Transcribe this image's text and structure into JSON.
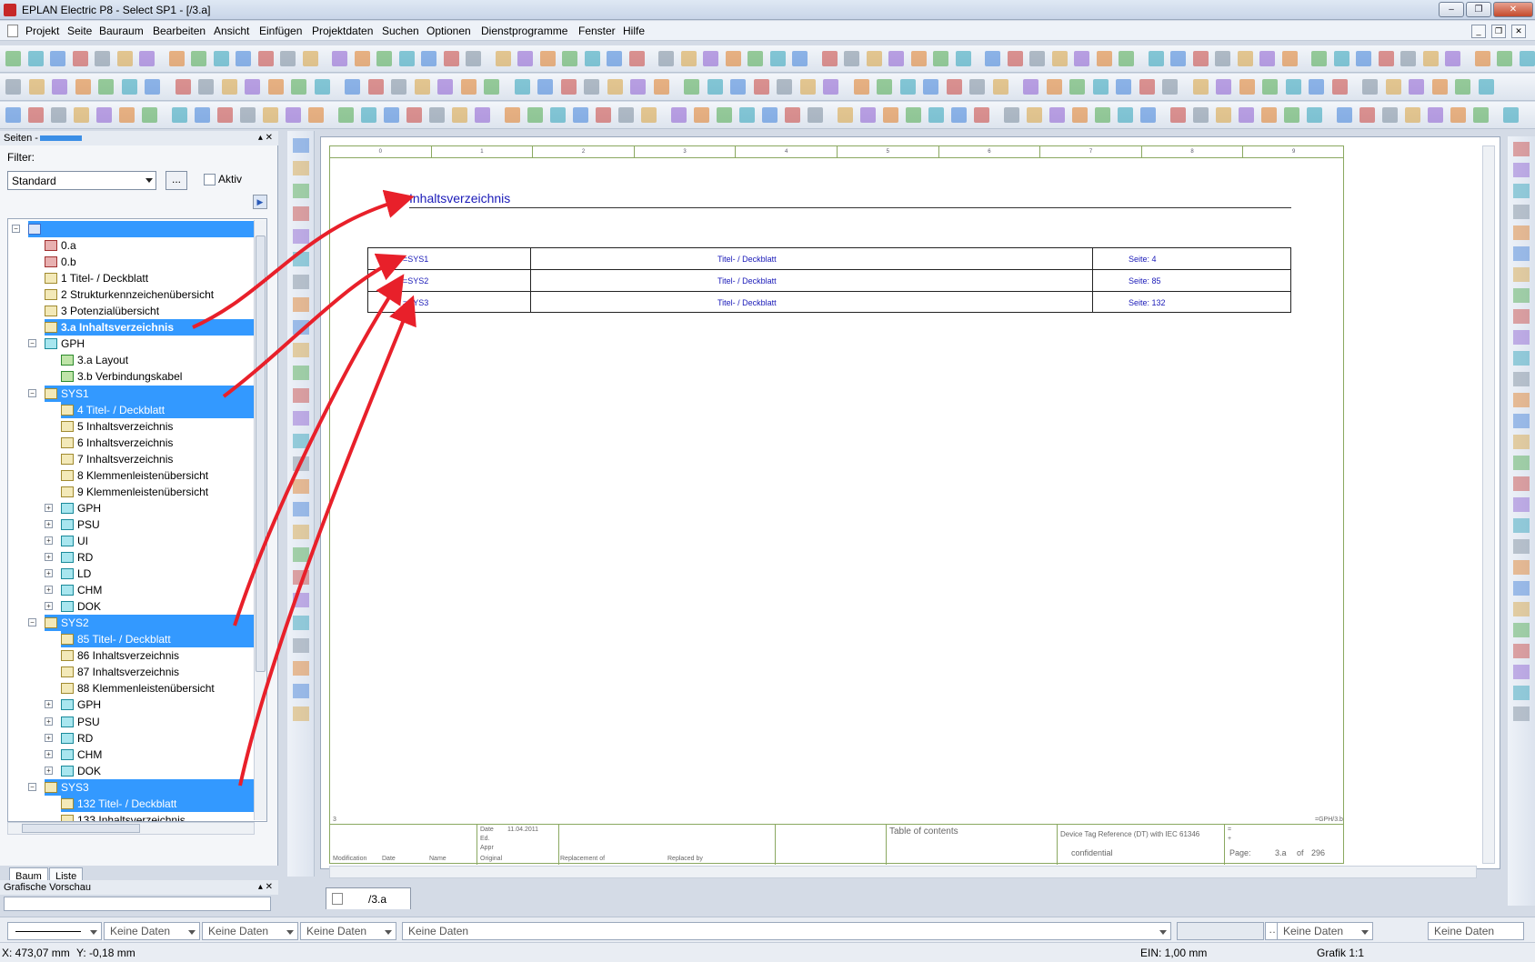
{
  "window": {
    "title": "EPLAN Electric P8 - Select SP1 - [/3.a]"
  },
  "menu": [
    "Projekt",
    "Seite",
    "Bauraum",
    "Bearbeiten",
    "Ansicht",
    "Einfügen",
    "Projektdaten",
    "Suchen",
    "Optionen",
    "Dienstprogramme",
    "Fenster",
    "Hilfe"
  ],
  "pages_panel": {
    "title": "Seiten -",
    "filter_label": "Filter:",
    "filter_value": "Standard",
    "filter_button": "...",
    "active_label": "Aktiv",
    "tabs": [
      "Baum",
      "Liste"
    ],
    "tree": [
      {
        "label": "",
        "level": 0,
        "icon": "project",
        "selected": true,
        "expander": "minus"
      },
      {
        "label": "0.a",
        "level": 1,
        "icon": "red"
      },
      {
        "label": "0.b",
        "level": 1,
        "icon": "red"
      },
      {
        "label": "1 Titel- / Deckblatt",
        "level": 1,
        "icon": "page"
      },
      {
        "label": "2 Strukturkennzeichenübersicht",
        "level": 1,
        "icon": "page"
      },
      {
        "label": "3 Potenzialübersicht",
        "level": 1,
        "icon": "page"
      },
      {
        "label": "3.a Inhaltsverzeichnis",
        "level": 1,
        "icon": "page",
        "selected": true,
        "bold": true
      },
      {
        "label": "GPH",
        "level": 1,
        "icon": "struct",
        "expander": "minus"
      },
      {
        "label": "3.a Layout",
        "level": 2,
        "icon": "green"
      },
      {
        "label": "3.b Verbindungskabel",
        "level": 2,
        "icon": "green"
      },
      {
        "label": "SYS1",
        "level": 1,
        "icon": "page",
        "selected": true,
        "expander": "minus"
      },
      {
        "label": "4 Titel- / Deckblatt",
        "level": 2,
        "icon": "page",
        "selected": true
      },
      {
        "label": "5 Inhaltsverzeichnis",
        "level": 2,
        "icon": "page"
      },
      {
        "label": "6 Inhaltsverzeichnis",
        "level": 2,
        "icon": "page"
      },
      {
        "label": "7 Inhaltsverzeichnis",
        "level": 2,
        "icon": "page"
      },
      {
        "label": "8 Klemmenleistenübersicht",
        "level": 2,
        "icon": "page"
      },
      {
        "label": "9 Klemmenleistenübersicht",
        "level": 2,
        "icon": "page"
      },
      {
        "label": "GPH",
        "level": 2,
        "icon": "struct",
        "expander": "plus"
      },
      {
        "label": "PSU",
        "level": 2,
        "icon": "struct",
        "expander": "plus"
      },
      {
        "label": "UI",
        "level": 2,
        "icon": "struct",
        "expander": "plus"
      },
      {
        "label": "RD",
        "level": 2,
        "icon": "struct",
        "expander": "plus"
      },
      {
        "label": "LD",
        "level": 2,
        "icon": "struct",
        "expander": "plus"
      },
      {
        "label": "CHM",
        "level": 2,
        "icon": "struct",
        "expander": "plus"
      },
      {
        "label": "DOK",
        "level": 2,
        "icon": "struct",
        "expander": "plus"
      },
      {
        "label": "SYS2",
        "level": 1,
        "icon": "page",
        "selected": true,
        "expander": "minus"
      },
      {
        "label": "85 Titel- / Deckblatt",
        "level": 2,
        "icon": "page",
        "selected": true
      },
      {
        "label": "86 Inhaltsverzeichnis",
        "level": 2,
        "icon": "page"
      },
      {
        "label": "87 Inhaltsverzeichnis",
        "level": 2,
        "icon": "page"
      },
      {
        "label": "88 Klemmenleistenübersicht",
        "level": 2,
        "icon": "page"
      },
      {
        "label": "GPH",
        "level": 2,
        "icon": "struct",
        "expander": "plus"
      },
      {
        "label": "PSU",
        "level": 2,
        "icon": "struct",
        "expander": "plus"
      },
      {
        "label": "RD",
        "level": 2,
        "icon": "struct",
        "expander": "plus"
      },
      {
        "label": "CHM",
        "level": 2,
        "icon": "struct",
        "expander": "plus"
      },
      {
        "label": "DOK",
        "level": 2,
        "icon": "struct",
        "expander": "plus"
      },
      {
        "label": "SYS3",
        "level": 1,
        "icon": "page",
        "selected": true,
        "expander": "minus"
      },
      {
        "label": "132 Titel- / Deckblatt",
        "level": 2,
        "icon": "page",
        "selected": true
      },
      {
        "label": "133 Inhaltsverzeichnis",
        "level": 2,
        "icon": "page"
      }
    ]
  },
  "preview_panel": {
    "title": "Grafische Vorschau"
  },
  "document": {
    "tab_label": "/3.a",
    "ruler": [
      "0",
      "1",
      "2",
      "3",
      "4",
      "5",
      "6",
      "7",
      "8",
      "9"
    ],
    "heading": "Inhaltsverzeichnis",
    "rows": [
      {
        "system": "=SYS1",
        "description": "Titel- / Deckblatt",
        "page": "Seite: 4"
      },
      {
        "system": "=SYS2",
        "description": "Titel- / Deckblatt",
        "page": "Seite: 85"
      },
      {
        "system": "=SYS3",
        "description": "Titel- / Deckblatt",
        "page": "Seite: 132"
      }
    ],
    "titleblock": {
      "date_label": "Date",
      "date_value": "11.04.2011",
      "ed_label": "Ed.",
      "appr_label": "Appr",
      "modification": "Modification",
      "date2": "Date",
      "name": "Name",
      "original": "Original",
      "replacement": "Replacement of",
      "replaced": "Replaced by",
      "toc": "Table of contents",
      "standard": "Device Tag Reference (DT) with IEC 61346",
      "confidential": "confidential",
      "page_label": "Page:",
      "page_value": "3.a",
      "of_label": "of",
      "page_total": "296",
      "eq1": "=",
      "eq2": "+",
      "ref": "=GPH/3.b",
      "row3": "3"
    }
  },
  "statusbar": {
    "fields": [
      "Keine Daten",
      "Keine Daten",
      "Keine Daten",
      "Keine Daten",
      "Keine Daten",
      "Keine Daten"
    ]
  },
  "coords": {
    "x": "X: 473,07 mm",
    "y": "Y: -0,18 mm",
    "grid": "EIN: 1,00 mm",
    "scale": "Grafik 1:1"
  },
  "colors": {
    "selection": "#3399ff",
    "annotation_arrow": "#e8202a",
    "doc_text": "#1a1ab8"
  }
}
